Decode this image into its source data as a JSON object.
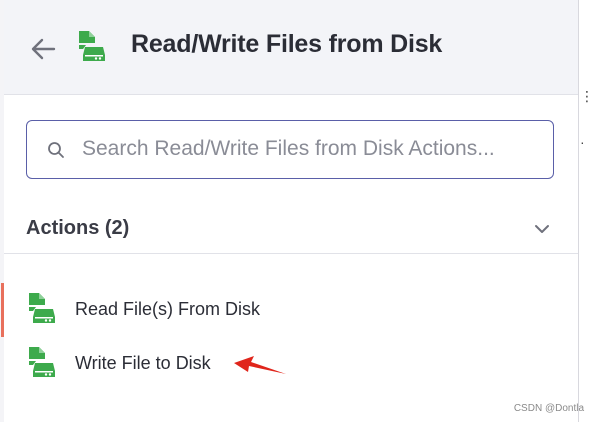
{
  "header": {
    "title": "Read/Write Files from Disk",
    "back_icon": "arrow-left-icon",
    "app_icon": "disk-file-icon"
  },
  "search": {
    "placeholder": "Search Read/Write Files from Disk Actions...",
    "value": ""
  },
  "actions_section": {
    "title": "Actions (2)",
    "items": [
      {
        "label": "Read File(s) From Disk",
        "icon": "disk-file-icon",
        "active": true
      },
      {
        "label": "Write File to Disk",
        "icon": "disk-file-icon",
        "active": false
      }
    ]
  },
  "colors": {
    "accent_green": "#3daa4c",
    "active_indicator": "#e8705c",
    "search_border": "#5a5fa8",
    "annotation_arrow": "#e0251b"
  },
  "watermark": "CSDN @Dontla"
}
